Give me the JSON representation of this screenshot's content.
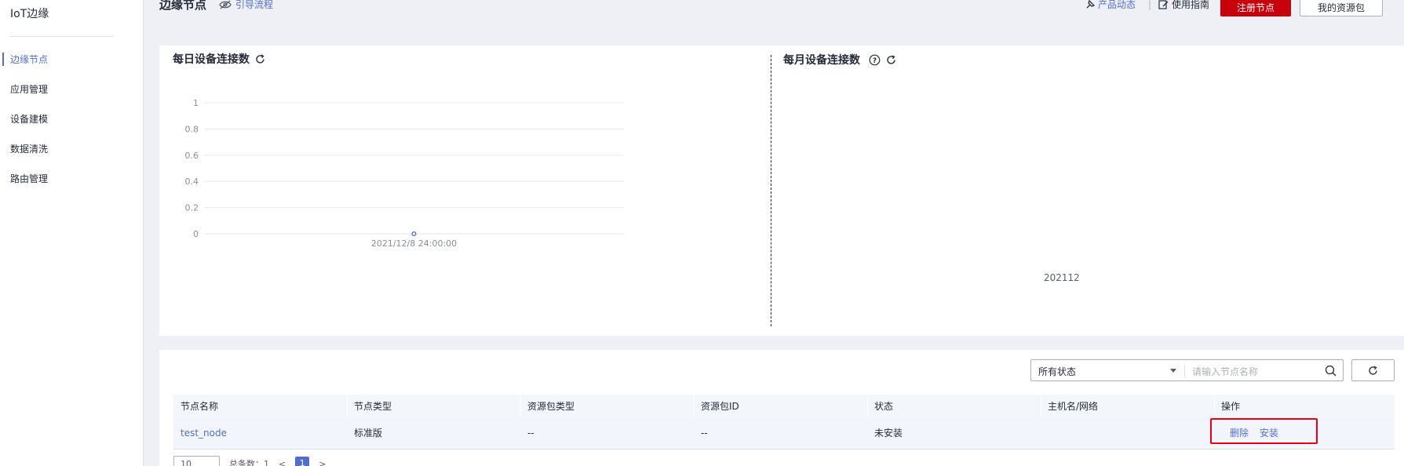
{
  "sidebar": {
    "title": "IoT边缘",
    "items": [
      {
        "label": "边缘节点",
        "active": true
      },
      {
        "label": "应用管理",
        "active": false
      },
      {
        "label": "设备建模",
        "active": false
      },
      {
        "label": "数据清洗",
        "active": false
      },
      {
        "label": "路由管理",
        "active": false
      }
    ]
  },
  "header": {
    "title": "边缘节点",
    "guide_label": "引导流程",
    "product_news_label": "产品动态",
    "separator": "|",
    "user_guide_label": "使用指南",
    "register_button": "注册节点",
    "my_packages_button": "我的资源包"
  },
  "daily_chart": {
    "title": "每日设备连接数"
  },
  "monthly_chart": {
    "title": "每月设备连接数",
    "x_label": "202112"
  },
  "chart_data": [
    {
      "type": "line",
      "title": "每日设备连接数",
      "x": [
        "2021/12/8 24:00:00"
      ],
      "series": [
        {
          "values": [
            0
          ]
        }
      ],
      "yticks": [
        "0",
        "0.2",
        "0.4",
        "0.6",
        "0.8",
        "1"
      ],
      "ylim": [
        0,
        1
      ],
      "grid": true
    },
    {
      "type": "bar",
      "title": "每月设备连接数",
      "categories": [
        "202112"
      ],
      "values": [
        0
      ]
    }
  ],
  "filters": {
    "status_select": "所有状态",
    "search_placeholder": "请输入节点名称"
  },
  "table": {
    "columns": [
      "节点名称",
      "节点类型",
      "资源包类型",
      "资源包ID",
      "状态",
      "主机名/网络",
      "操作"
    ],
    "rows": [
      {
        "name": "test_node",
        "type": "标准版",
        "package_type": "--",
        "package_id": "--",
        "status": "未安装",
        "host": "",
        "ops": [
          "删除",
          "安装"
        ]
      }
    ]
  },
  "pagination": {
    "page_size": "10",
    "total_label": "总条数：1",
    "prev": "<",
    "current_page": "1",
    "next": ">"
  },
  "colors": {
    "accent": "#526ecc",
    "primary_button": "#c7000b",
    "highlight_border": "#e60012"
  }
}
